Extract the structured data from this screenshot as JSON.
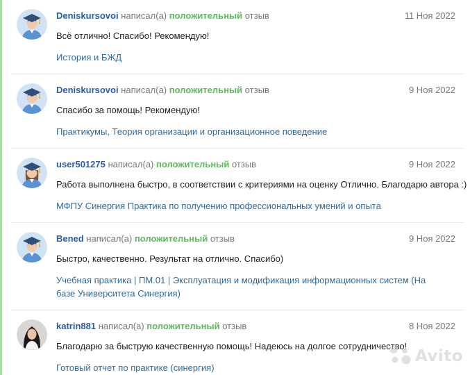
{
  "reviews": [
    {
      "author": "Deniskursovoi",
      "verb_before": "написал(а)",
      "rating": "положительный",
      "verb_after": "отзыв",
      "date": "11 Ноя 2022",
      "text": "Всё отлично! Спасибо! Рекомендую!",
      "subject": "История и БЖД",
      "avatar": "graduate-boy-icon"
    },
    {
      "author": "Deniskursovoi",
      "verb_before": "написал(а)",
      "rating": "положительный",
      "verb_after": "отзыв",
      "date": "9 Ноя 2022",
      "text": "Спасибо за помощь! Рекомендую!",
      "subject": "Практикумы, Теория организации и организационное поведение",
      "avatar": "graduate-boy-icon"
    },
    {
      "author": "user501275",
      "verb_before": "написал(а)",
      "rating": "положительный",
      "verb_after": "отзыв",
      "date": "9 Ноя 2022",
      "text": "Работа выполнена быстро, в соответствии с критериями на оценку Отлично. Благодарю автора :)",
      "subject": "МФПУ Синергия Практика по получению профессиональных умений и опыта",
      "avatar": "graduate-girl-icon"
    },
    {
      "author": "Bened",
      "verb_before": "написал(а)",
      "rating": "положительный",
      "verb_after": "отзыв",
      "date": "9 Ноя 2022",
      "text": "Быстро, качественно. Результат на отлично. Спасибо)",
      "subject": "Учебная практика | ПМ.01 | Эксплуатация и модификация информационных систем (На базе Университета Синергия)",
      "avatar": "graduate-boy-icon"
    },
    {
      "author": "katrin881",
      "verb_before": "написал(а)",
      "rating": "положительный",
      "verb_after": "отзыв",
      "date": "8 Ноя 2022",
      "text": "Благодарю за быструю качественную помощь! Надеюсь на долгое сотрудничество!",
      "subject": "Готовый отчет по практике (синергия)",
      "avatar": "user-photo"
    }
  ],
  "watermark": {
    "text": "Avito",
    "icon": "avito-logo-icon"
  },
  "colors": {
    "author": "#2b5ea8",
    "positive": "#5bba5b",
    "subject_link": "#2e6a9e",
    "muted": "#777777",
    "left_border": "#a8e1a3"
  }
}
